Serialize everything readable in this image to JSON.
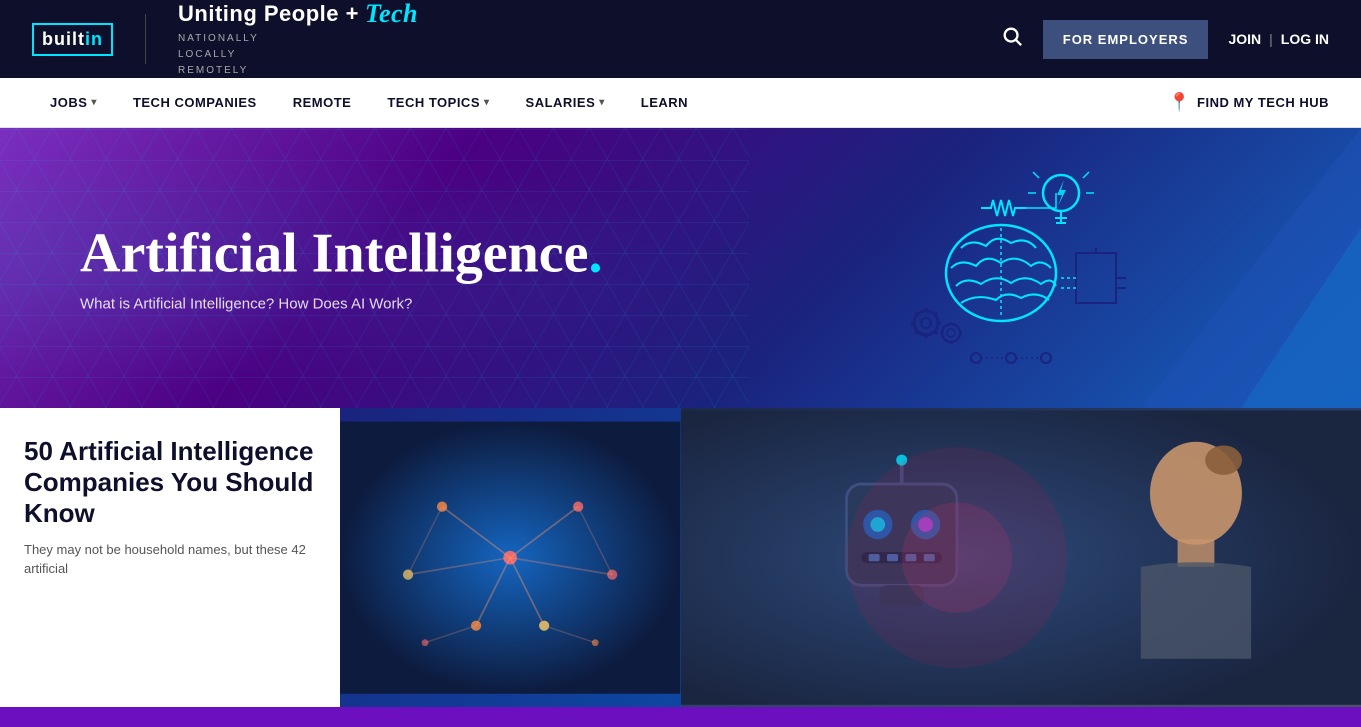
{
  "header": {
    "logo_text_built": "built",
    "logo_text_in": "in",
    "brand_tagline_main": "Uniting People + Tech",
    "brand_tagline_tech_italic": "Tech",
    "brand_sub_line1": "NATIONALLY",
    "brand_sub_line2": "LOCALLY",
    "brand_sub_line3": "REMOTELY",
    "for_employers_label": "FOR EMPLOYERS",
    "join_label": "JOIN",
    "login_label": "LOG IN"
  },
  "nav": {
    "items": [
      {
        "label": "JOBS",
        "has_dropdown": true
      },
      {
        "label": "TECH COMPANIES",
        "has_dropdown": false
      },
      {
        "label": "REMOTE",
        "has_dropdown": false
      },
      {
        "label": "TECH TOPICS",
        "has_dropdown": true
      },
      {
        "label": "SALARIES",
        "has_dropdown": true
      },
      {
        "label": "LEARN",
        "has_dropdown": false
      }
    ],
    "find_hub_label": "FIND MY TECH HUB"
  },
  "hero": {
    "title": "Artificial Intelligence",
    "title_dot": ".",
    "subtitle": "What is Artificial Intelligence? How Does AI Work?"
  },
  "articles": {
    "card1": {
      "title": "50 Artificial Intelligence Companies You Should Know",
      "excerpt": "They may not be household names, but these 42 artificial"
    },
    "card2": {
      "title": ""
    }
  },
  "colors": {
    "accent_cyan": "#00e5ff",
    "nav_bg": "#ffffff",
    "header_bg": "#0d0f2b",
    "hero_purple": "#7b2fbe",
    "hero_blue": "#1565c0",
    "article_bg": "#6b0fbf"
  }
}
